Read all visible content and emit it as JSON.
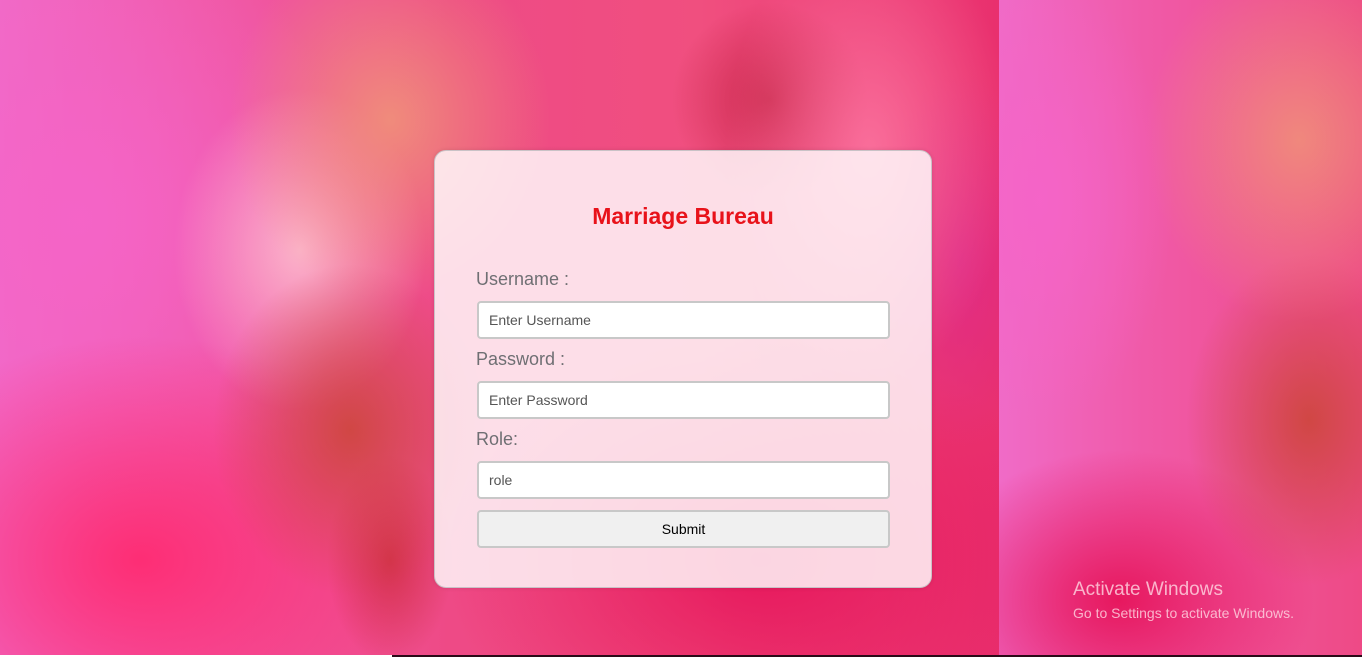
{
  "app": {
    "title": "Marriage Bureau"
  },
  "form": {
    "username": {
      "label": "Username :",
      "placeholder": "Enter Username",
      "value": ""
    },
    "password": {
      "label": "Password :",
      "placeholder": "Enter Password",
      "value": ""
    },
    "role": {
      "label": "Role:",
      "placeholder": "role",
      "value": ""
    },
    "submit_label": "Submit"
  },
  "watermark": {
    "title": "Activate Windows",
    "subtitle": "Go to Settings to activate Windows."
  },
  "colors": {
    "title": "#e8121a",
    "background_accent": "#e8145f",
    "label": "#6f6f73"
  }
}
